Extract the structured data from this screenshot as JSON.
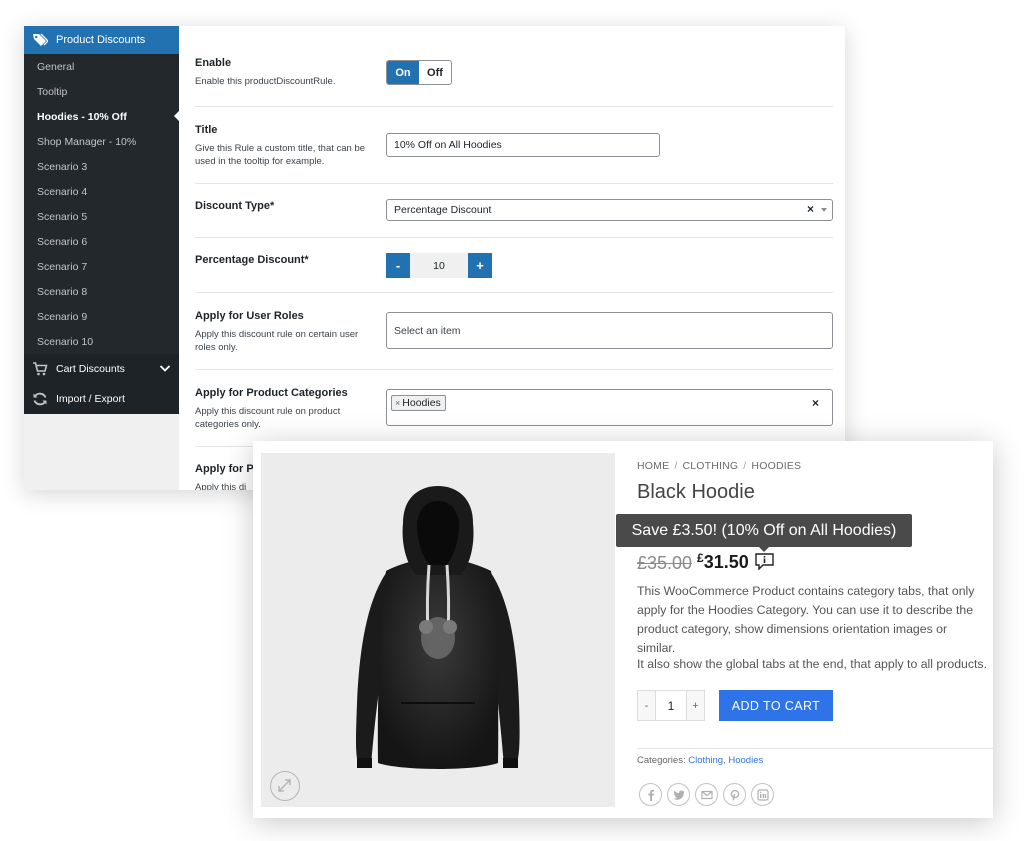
{
  "admin": {
    "sidebar": {
      "header": "Product Discounts",
      "items": [
        {
          "label": "General"
        },
        {
          "label": "Tooltip"
        },
        {
          "label": "Hoodies - 10% Off"
        },
        {
          "label": "Shop Manager - 10%"
        },
        {
          "label": "Scenario 3"
        },
        {
          "label": "Scenario 4"
        },
        {
          "label": "Scenario 5"
        },
        {
          "label": "Scenario 6"
        },
        {
          "label": "Scenario 7"
        },
        {
          "label": "Scenario 8"
        },
        {
          "label": "Scenario 9"
        },
        {
          "label": "Scenario 10"
        }
      ],
      "active_item": "Hoodies - 10% Off",
      "menus": [
        {
          "label": "Cart Discounts",
          "icon": "cart-icon"
        },
        {
          "label": "Import / Export",
          "icon": "refresh-icon"
        }
      ]
    },
    "fields": {
      "enable": {
        "label": "Enable",
        "desc": "Enable this productDiscountRule.",
        "on": "On",
        "off": "Off"
      },
      "title": {
        "label": "Title",
        "desc": "Give this Rule a custom title, that can be used in the tooltip for example.",
        "value": "10% Off on All Hoodies"
      },
      "discount_type": {
        "label": "Discount Type*",
        "value": "Percentage Discount",
        "clear": "×"
      },
      "percentage": {
        "label": "Percentage Discount*",
        "minus": "-",
        "value": "10",
        "plus": "+"
      },
      "user_roles": {
        "label": "Apply for User Roles",
        "desc": "Apply this discount rule on certain user roles only.",
        "placeholder": "Select an item"
      },
      "categories": {
        "label": "Apply for Product Categories",
        "desc": "Apply this discount rule on product categories only.",
        "chip": "Hoodies",
        "chip_x": "×",
        "clear": "×"
      },
      "partial": {
        "label": "Apply for P",
        "desc": "Apply this di"
      }
    },
    "accent_color": "#2271b1"
  },
  "product": {
    "breadcrumb": [
      "HOME",
      "CLOTHING",
      "HOODIES"
    ],
    "breadcrumb_sep": "/",
    "title": "Black Hoodie",
    "tooltip": "Save £3.50! (10% Off on All Hoodies)",
    "old_price": "£35.00",
    "currency": "£",
    "new_price": "31.50",
    "description": [
      "This WooCommerce Product contains category tabs, that only apply for the Hoodies Category. You can use it to describe the product category, show dimensions orientation images or similar.",
      "It also show the global tabs at the end, that apply to all products."
    ],
    "qty_minus": "-",
    "qty": "1",
    "qty_plus": "+",
    "add_to_cart": "ADD TO CART",
    "categories_label": "Categories:",
    "categories": [
      "Clothing",
      "Hoodies"
    ],
    "categories_sep": ",",
    "share_icons": [
      "facebook-icon",
      "twitter-icon",
      "email-icon",
      "pinterest-icon",
      "linkedin-icon"
    ],
    "button_color": "#2f73e8"
  }
}
